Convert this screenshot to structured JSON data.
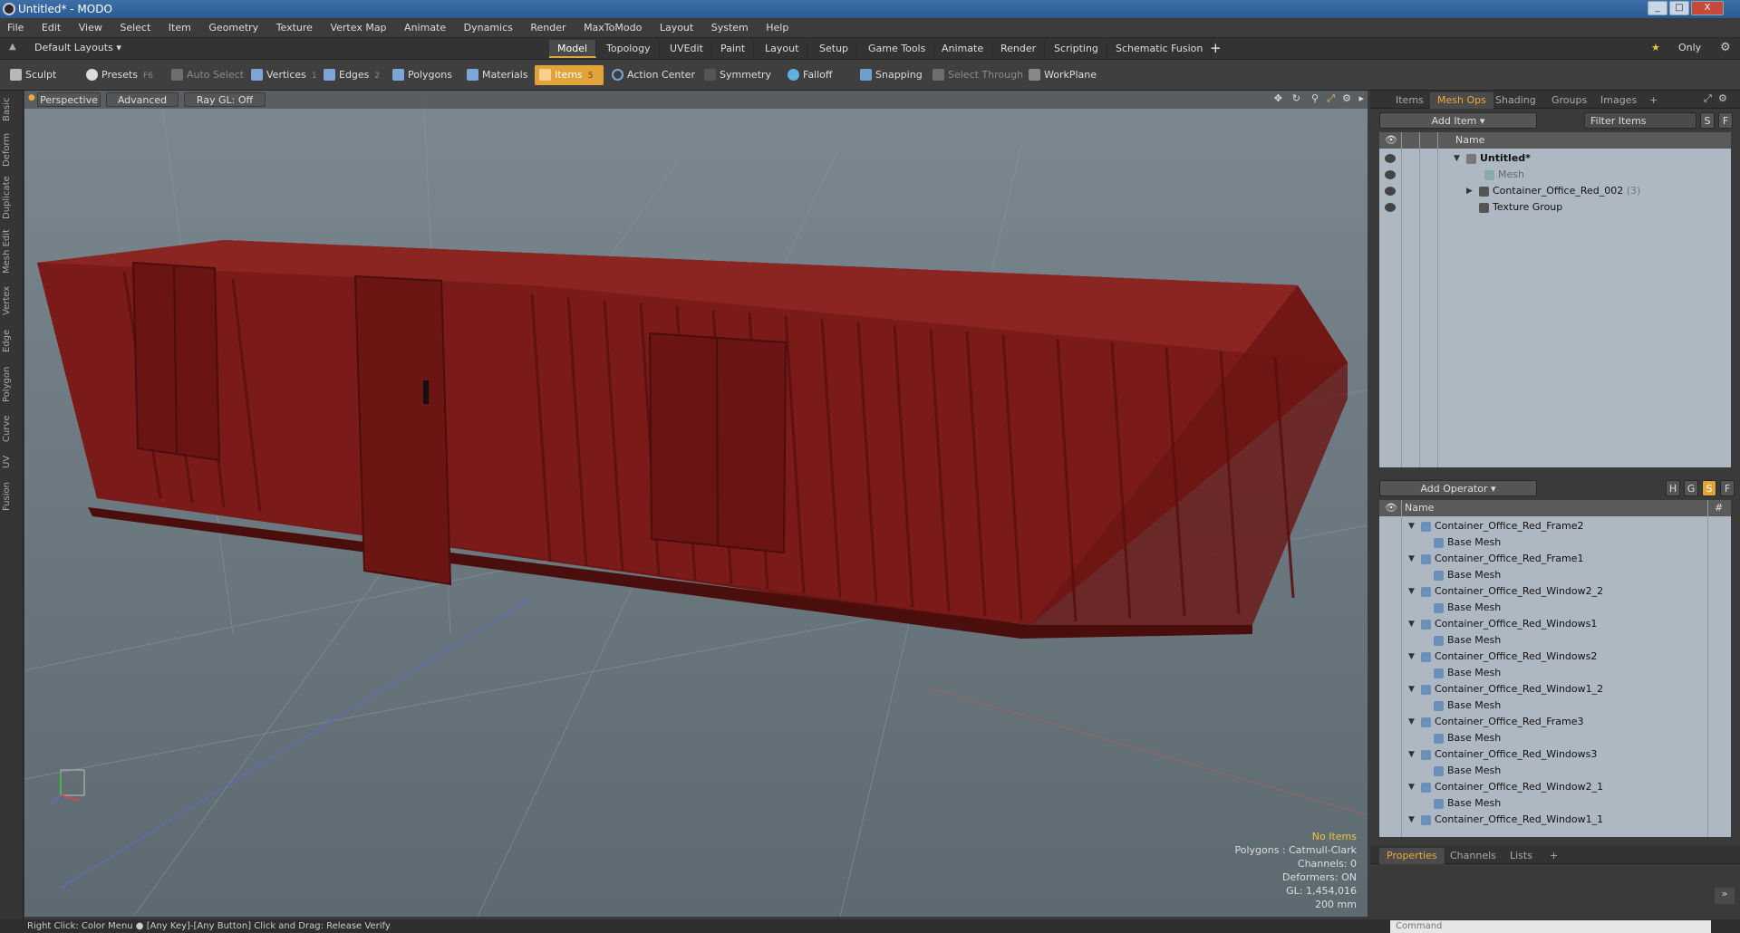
{
  "window": {
    "title": "Untitled* - MODO",
    "min": "_",
    "max": "□",
    "close": "X"
  },
  "menu": [
    "File",
    "Edit",
    "View",
    "Select",
    "Item",
    "Geometry",
    "Texture",
    "Vertex Map",
    "Animate",
    "Dynamics",
    "Render",
    "MaxToModo",
    "Layout",
    "System",
    "Help"
  ],
  "layoutbar": {
    "preset": "Default Layouts",
    "tabs": [
      "Model",
      "Topology",
      "UVEdit",
      "Paint",
      "Layout",
      "Setup",
      "Game Tools",
      "Animate",
      "Render",
      "Scripting",
      "Schematic Fusion"
    ],
    "active_tab": "Model",
    "add": "+",
    "only_label": "Only"
  },
  "toolbar": {
    "sculpt": "Sculpt",
    "presets": "Presets",
    "presets_key": "F6",
    "auto_select": "Auto Select",
    "vertices": "Vertices",
    "vertices_count": "1",
    "edges": "Edges",
    "edges_count": "2",
    "polygons": "Polygons",
    "materials": "Materials",
    "items": "Items",
    "items_count": "5",
    "action_center": "Action Center",
    "symmetry": "Symmetry",
    "falloff": "Falloff",
    "snapping": "Snapping",
    "select_through": "Select Through",
    "workplane": "WorkPlane"
  },
  "left_tabs": [
    "Basic",
    "Deform",
    "Duplicate",
    "Mesh Edit",
    "Vertex",
    "Edge",
    "Polygon",
    "Curve",
    "UV",
    "Fusion"
  ],
  "viewport": {
    "view": "Perspective",
    "shading": "Advanced",
    "raygl": "Ray GL: Off",
    "info": {
      "no_items": "No Items",
      "polygons": "Polygons : Catmull-Clark",
      "channels": "Channels: 0",
      "deformers": "Deformers: ON",
      "gl": "GL: 1,454,016",
      "scale": "200 mm"
    }
  },
  "item_panel": {
    "tabs": [
      "Items",
      "Mesh Ops",
      "Shading",
      "Groups",
      "Images"
    ],
    "active_tab": "Mesh Ops",
    "add_item": "Add Item",
    "filter": "Filter Items",
    "col_name": "Name",
    "rows": [
      {
        "label": "Untitled*",
        "bold": true
      },
      {
        "label": "Mesh",
        "dim": true
      },
      {
        "label": "Container_Office_Red_002",
        "suffix": "(3)"
      },
      {
        "label": "Texture Group"
      }
    ]
  },
  "operator_panel": {
    "add_operator": "Add Operator",
    "col_name": "Name",
    "col_hash": "#",
    "rows": [
      {
        "label": "Container_Office_Red_Frame2",
        "child": "Base Mesh"
      },
      {
        "label": "Container_Office_Red_Frame1",
        "child": "Base Mesh"
      },
      {
        "label": "Container_Office_Red_Window2_2",
        "child": "Base Mesh"
      },
      {
        "label": "Container_Office_Red_Windows1",
        "child": "Base Mesh"
      },
      {
        "label": "Container_Office_Red_Windows2",
        "child": "Base Mesh"
      },
      {
        "label": "Container_Office_Red_Window1_2",
        "child": "Base Mesh"
      },
      {
        "label": "Container_Office_Red_Frame3",
        "child": "Base Mesh"
      },
      {
        "label": "Container_Office_Red_Windows3",
        "child": "Base Mesh"
      },
      {
        "label": "Container_Office_Red_Window2_1",
        "child": "Base Mesh"
      },
      {
        "label": "Container_Office_Red_Window1_1",
        "child": ""
      }
    ]
  },
  "properties_panel": {
    "tabs": [
      "Properties",
      "Channels",
      "Lists"
    ],
    "active_tab": "Properties"
  },
  "status": {
    "hint": "Right Click: Color Menu  ●  [Any Key]-[Any Button] Click and Drag: Release Verify",
    "command_placeholder": "Command"
  },
  "colors": {
    "accent": "#e2a43a",
    "container_red": "#7a1a18",
    "viewport_bg": "#6e7a82"
  }
}
